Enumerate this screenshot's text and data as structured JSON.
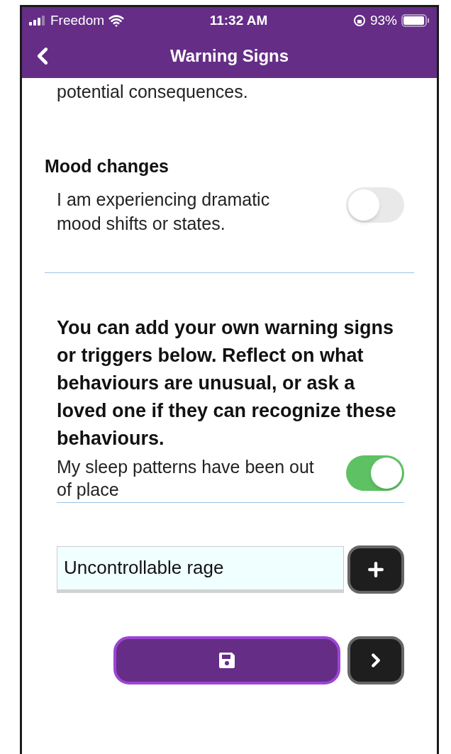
{
  "status_bar": {
    "carrier": "Freedom",
    "time": "11:32 AM",
    "battery": "93%"
  },
  "nav": {
    "title": "Warning Signs"
  },
  "intro_tail": "potential consequences.",
  "sections": [
    {
      "heading": "Mood changes",
      "items": [
        {
          "label": "I am experiencing dramatic mood shifts or states.",
          "on": false
        }
      ]
    }
  ],
  "custom": {
    "instructions": "You can add your own warning signs or triggers below. Reflect on what behaviours are unusual, or ask a loved one if they can recognize these behaviours.",
    "items": [
      {
        "label": "My sleep patterns have been out of place",
        "on": true
      }
    ],
    "new_item": {
      "value": "Uncontrollable rage"
    }
  }
}
